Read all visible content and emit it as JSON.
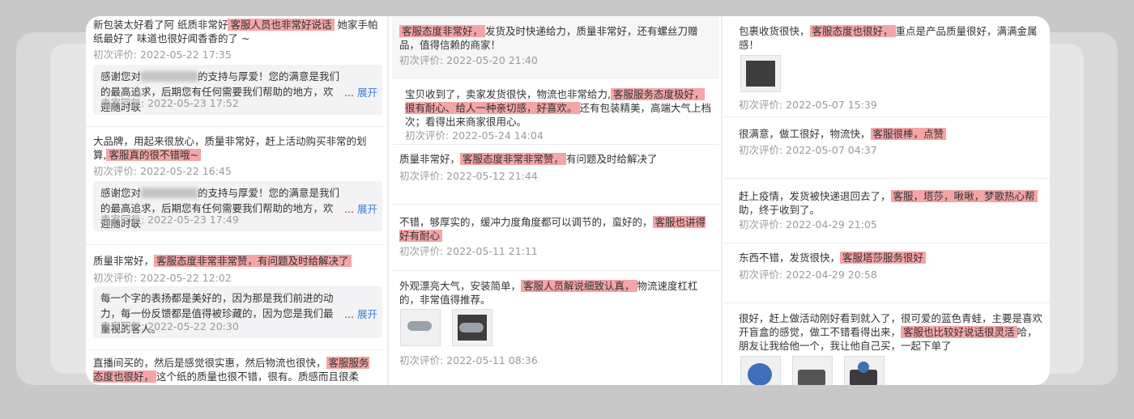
{
  "col1": [
    {
      "pre": "新包装太好看了阿 纸质非常好",
      "hl": "客服人员也非常好说话",
      "post": " 她家手帕纸最好了 味道也很好闻香香的了 ~",
      "date": "初次评价: 2022-05-22 17:35",
      "reply_pre": "感谢您对",
      "reply_post": "的支持与厚爱！您的满意是我们的最高追求，后期您有任何需要我们帮助的地方，欢迎随时联",
      "reply_date": "卖家回复: 2022-05-23 17:52"
    },
    {
      "pre": "大品牌，用起来很放心，质量非常好，赶上活动购买非常的划算,",
      "hl": "客服真的很不错哦~",
      "post": "",
      "date": "初次评价: 2022-05-22 16:45",
      "reply_pre": "感谢您对",
      "reply_post": "的支持与厚爱！您的满意是我们的最高追求，后期您有任何需要我们帮助的地方，欢迎随时联",
      "reply_date": "卖家回复: 2022-05-23 17:49"
    },
    {
      "pre": "质量非常好，",
      "hl": "客服态度非常非常赞，有问题及时给解决了",
      "post": "",
      "date": "初次评价: 2022-05-22 12:02",
      "reply_pre": "",
      "reply_post": "每一个字的表扬都是美好的，因为那是我们前进的动力，每一份反馈都是值得被珍藏的，因为您是我们最重视的客人。",
      "reply_date": "卖家回复: 2022-05-22 20:30"
    },
    {
      "pre": "直播间买的，然后是感觉很实惠，然后物流也很快，",
      "hl": "客服服务态度也很好，",
      "post": "这个纸的质量也很不错，很有。质感而且很柔软，很吸",
      "date": ""
    }
  ],
  "col2": [
    {
      "pre": "",
      "hl": "客服态度非常好，",
      "post": "发货及时快递给力，质量非常好，还有螺丝刀赠品，值得信赖的商家！",
      "date": "初次评价: 2022-05-20 21:40"
    },
    {
      "pre": "宝贝收到了，卖家发货很快，物流也非常给力,",
      "hl": "客服服务态度极好，很有耐心、给人一种亲切感，好喜欢。",
      "post": "还有包装精美，高端大气上档次；看得出来商家很用心。",
      "date": "初次评价: 2022-05-24 14:04"
    },
    {
      "pre": "质量非常好，",
      "hl": "客服态度非常非常赞，",
      "post": "有问题及时给解决了",
      "date": "初次评价: 2022-05-12 21:44"
    },
    {
      "pre": "不错，够厚实的，缓冲力度角度都可以调节的，蛮好的，",
      "hl": "客服也讲得好有耐心",
      "post": "",
      "date": "初次评价: 2022-05-11 21:11"
    },
    {
      "pre": "外观漂亮大气，安装简单，",
      "hl": "客服人员解说细致认真，",
      "post": "物流速度杠杠的，非常值得推荐。",
      "date": "初次评价: 2022-05-11 08:36"
    }
  ],
  "col3": [
    {
      "pre": "包裹收货很快，",
      "hl": "客服态度也很好，",
      "post": "重点是产品质量很好，满满金属感！",
      "date": "初次评价: 2022-05-07 15:39"
    },
    {
      "pre": "很满意，做工很好，物流快，",
      "hl": "客服很棒，点赞",
      "post": "",
      "date": "初次评价: 2022-05-07 04:37"
    },
    {
      "pre": "赶上疫情，发货被快递退回去了，",
      "hl": "客服，塔莎，啾啾，梦歌热心帮",
      "post": "助，终于收到了。",
      "date": "初次评价: 2022-04-29 21:05"
    },
    {
      "pre": "东西不错，发货很快，",
      "hl": "客服塔莎服务很好",
      "post": "",
      "date": "初次评价: 2022-04-29 20:58"
    },
    {
      "pre": "很好，赶上做活动刚好看到就入了，很可爱的蓝色青蛙，主要是喜欢开盲盒的感觉，做工不错看得出来，",
      "hl": "客服也比较好说话很灵活",
      "post": "哈，朋友让我给他一个，我让他自己买，一起下单了",
      "date": ""
    }
  ],
  "ui": {
    "expand": "展开",
    "ellipsis": "..."
  }
}
